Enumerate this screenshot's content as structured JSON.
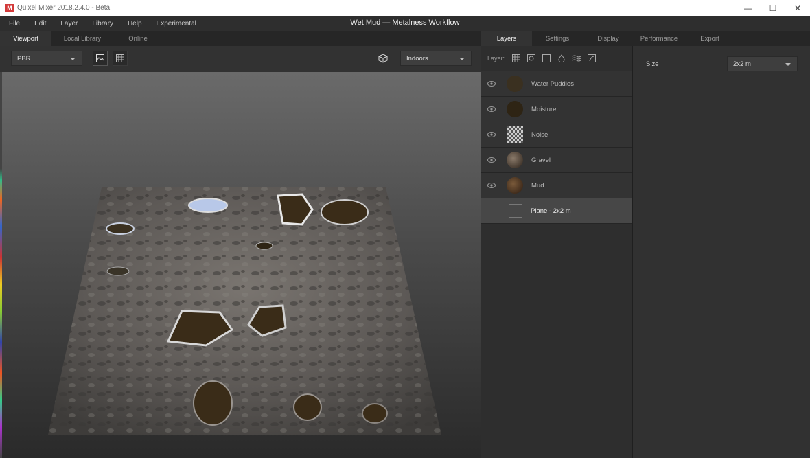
{
  "window": {
    "title": "Quixel Mixer 2018.2.4.0 - Beta",
    "logo_letter": "M",
    "controls": {
      "minimize": "—",
      "maximize": "☐",
      "close": "✕"
    }
  },
  "menu": {
    "items": [
      "File",
      "Edit",
      "Layer",
      "Library",
      "Help",
      "Experimental"
    ],
    "document_title": "Wet Mud — Metalness Workflow"
  },
  "left_tabs": [
    "Viewport",
    "Local Library",
    "Online"
  ],
  "viewport_toolbar": {
    "render_mode": "PBR",
    "environment": "Indoors"
  },
  "right_tabs": [
    "Layers",
    "Settings",
    "Display",
    "Performance",
    "Export"
  ],
  "layers": {
    "toolbar_label": "Layer:",
    "items": [
      {
        "name": "Water Puddles",
        "visible": true,
        "thumb_color": "#3a3020"
      },
      {
        "name": "Moisture",
        "visible": true,
        "thumb_color": "#2e2414"
      },
      {
        "name": "Noise",
        "visible": true,
        "thumb_color": "#888888"
      },
      {
        "name": "Gravel",
        "visible": true,
        "thumb_color": "#5a4a3c"
      },
      {
        "name": "Mud",
        "visible": true,
        "thumb_color": "#4a3a28"
      },
      {
        "name": "Plane - 2x2 m",
        "visible": false,
        "thumb_color": "#474747"
      }
    ]
  },
  "properties": {
    "size_label": "Size",
    "size_value": "2x2 m"
  },
  "colors": {
    "accent": "#d33a3a",
    "panel": "#2e2e2e",
    "selected_row": "#474747"
  }
}
